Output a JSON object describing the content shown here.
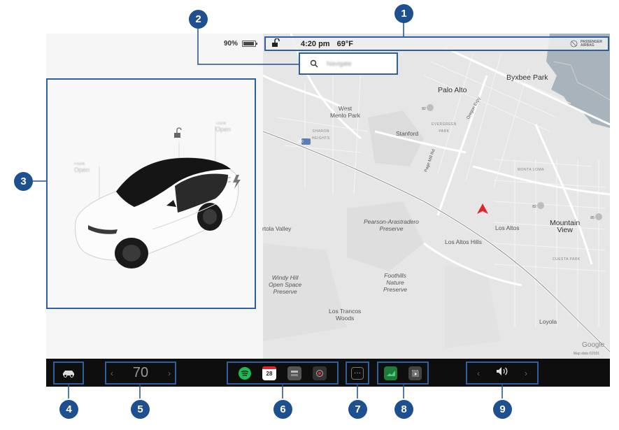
{
  "status": {
    "battery_percent": "90%",
    "time": "4:20 pm",
    "temperature": "69°F",
    "airbag_line1": "PASSENGER",
    "airbag_line2": "AIRBAG"
  },
  "search": {
    "placeholder": "Navigate"
  },
  "car": {
    "frunk_label": "Frunk",
    "frunk_state": "Open",
    "trunk_label": "Trunk",
    "trunk_state": "Open"
  },
  "map": {
    "labels": {
      "byxbee_park": "Byxbee Park",
      "palo_alto": "Palo Alto",
      "west_menlo_park_1": "West",
      "west_menlo_park_2": "Menlo Park",
      "sharon_heights_1": "SHARON",
      "sharon_heights_2": "HEIGHTS",
      "evergreen_park_1": "EVERGREEN",
      "evergreen_park_2": "PARK",
      "stanford": "Stanford",
      "oregon_expy": "Oregon Expy",
      "page_mill_rd": "Page Mill Rd",
      "montaloma": "MONTA LOMA",
      "mountain_view_1": "Mountain",
      "mountain_view_2": "View",
      "los_altos": "Los Altos",
      "cuesta_park": "CUESTA PARK",
      "pearson_1": "Pearson-Arastradero",
      "pearson_2": "Preserve",
      "portola_valley": "rtola Valley",
      "los_altos_hills": "Los Altos Hills",
      "foothills_1": "Foothills",
      "foothills_2": "Nature",
      "foothills_3": "Preserve",
      "windy_hill_1": "Windy Hill",
      "windy_hill_2": "Open Space",
      "windy_hill_3": "Preserve",
      "los_trancos_1": "Los Trancos",
      "los_trancos_2": "Woods",
      "loyola": "Loyola",
      "shield_280": "280",
      "shield_82a": "82",
      "shield_82b": "82",
      "shield_85": "85"
    },
    "google": "Google",
    "map_data": "Map data ©2021"
  },
  "taskbar": {
    "cabin_temp": "70",
    "chev_left": "‹",
    "chev_right": "›",
    "more_label": "···",
    "calendar_day": "28"
  },
  "callouts": [
    "1",
    "2",
    "3",
    "4",
    "5",
    "6",
    "7",
    "8",
    "9"
  ],
  "colors": {
    "callout": "#1e4f8e",
    "highlight_border": "#2e5f9e",
    "nav_arrow": "#e0262a",
    "spotify": "#1db954",
    "taskbar": "#0e0e0e"
  },
  "icons": {
    "lock": "unlocked-padlock-icon",
    "airbag": "airbag-off-icon",
    "search": "search-icon",
    "car": "car-icon",
    "volume": "volume-icon"
  }
}
